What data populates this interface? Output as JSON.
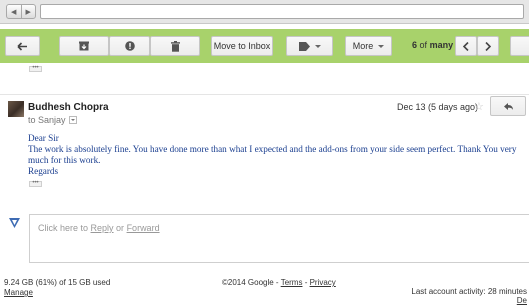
{
  "toolbar": {
    "move_to_inbox": "Move to Inbox",
    "more": "More",
    "pager_position": "6",
    "pager_of": "of",
    "pager_total": "many"
  },
  "message": {
    "sender": "Budhesh Chopra",
    "to": "to Sanjay",
    "date": "Dec 13 (5 days ago)",
    "star": "☆",
    "body": [
      "Dear Sir",
      "The work is absolutely fine. You have done more than what I expected and the add-ons from your side seem perfect. Thank You very much for this work.",
      "Regards"
    ],
    "ellipsis": "•••"
  },
  "reply": {
    "prefix": "Click here to ",
    "reply_link": "Reply",
    "or": " or ",
    "forward_link": "Forward"
  },
  "footer": {
    "storage": "9.24 GB (61%) of 15 GB used",
    "manage": "Manage",
    "copyright": "©2014 Google - ",
    "terms": "Terms",
    "dash": " - ",
    "privacy": "Privacy",
    "activity": "Last account activity: 28 minutes",
    "details": "De"
  },
  "colors": {
    "toolbar_bg": "#a8d26b",
    "body_text": "#1a3e8f"
  },
  "icons": [
    "back-arrow-icon",
    "archive-icon",
    "report-spam-icon",
    "delete-icon",
    "label-icon",
    "chevron-left-icon",
    "chevron-right-icon",
    "reply-icon",
    "star-icon"
  ]
}
